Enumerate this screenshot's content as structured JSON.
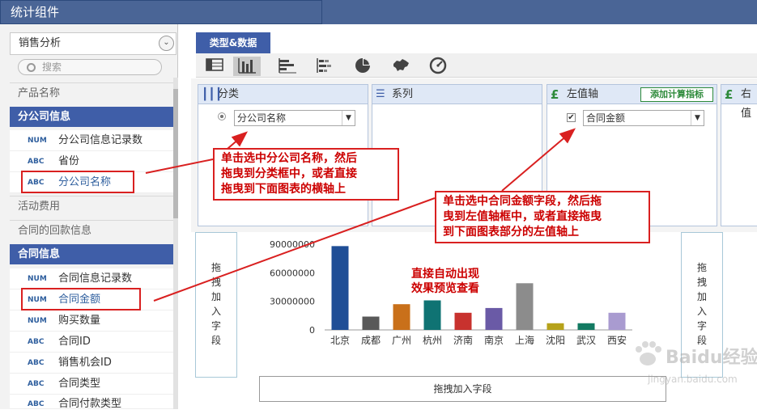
{
  "window": {
    "title": "统计组件"
  },
  "left": {
    "datasource": "销售分析",
    "search_placeholder": "搜索",
    "groups": {
      "product": "产品名称",
      "branch": "分公司信息",
      "activity": "活动费用",
      "payment": "合同的回款信息",
      "contract": "合同信息"
    },
    "branch_fields": [
      {
        "type": "NUM",
        "label": "分公司信息记录数"
      },
      {
        "type": "ABC",
        "label": "省份"
      },
      {
        "type": "ABC",
        "label": "分公司名称"
      }
    ],
    "contract_fields": [
      {
        "type": "NUM",
        "label": "合同信息记录数"
      },
      {
        "type": "NUM",
        "label": "合同金额"
      },
      {
        "type": "NUM",
        "label": "购买数量"
      },
      {
        "type": "ABC",
        "label": "合同ID"
      },
      {
        "type": "ABC",
        "label": "销售机会ID"
      },
      {
        "type": "ABC",
        "label": "合同类型"
      },
      {
        "type": "ABC",
        "label": "合同付款类型"
      }
    ]
  },
  "main": {
    "tab": "类型&数据",
    "chart_types": [
      "table-icon",
      "bar-chart-icon",
      "horizontal-bar-icon",
      "stacked-bar-icon",
      "pie-chart-icon",
      "map-icon",
      "gauge-icon"
    ],
    "wells": {
      "category": {
        "title": "分类",
        "value": "分公司名称"
      },
      "series": {
        "title": "系列"
      },
      "left_axis": {
        "title": "左值轴",
        "add_label": "添加计算指标",
        "value": "合同金额"
      },
      "right_axis": {
        "title": "右值"
      }
    },
    "drop_side": "拖拽加入字段",
    "drop_bottom": "拖拽加入字段",
    "preview_note_1": "直接自动出现",
    "preview_note_2": "效果预览查看"
  },
  "callouts": {
    "c1": [
      "单击选中分公司名称，然后",
      "拖曳到分类框中，或者直接",
      "拖曳到下面图表的横轴上"
    ],
    "c2": [
      "单击选中合同金额字段，然后拖",
      "曳到左值轴框中，或者直接拖曳",
      "到下面图表部分的左值轴上"
    ]
  },
  "watermark": {
    "brand": "Baidu经验",
    "url": "jingyan.baidu.com"
  },
  "colors": {
    "brand": "#3f5ea8",
    "highlight": "#d92020"
  },
  "chart_data": {
    "type": "bar",
    "categories": [
      "北京",
      "成都",
      "广州",
      "杭州",
      "济南",
      "南京",
      "上海",
      "沈阳",
      "武汉",
      "西安"
    ],
    "values": [
      88000000,
      14000000,
      27000000,
      31000000,
      18000000,
      23000000,
      49000000,
      7000000,
      7000000,
      18000000
    ],
    "bar_colors": [
      "#1f4e96",
      "#595959",
      "#c9701a",
      "#0f7373",
      "#c8322e",
      "#6a5aa6",
      "#8c8c8c",
      "#b6a21a",
      "#137a62",
      "#a99bd0"
    ],
    "yticks": [
      "0",
      "30000000",
      "60000000",
      "90000000"
    ],
    "ylim": [
      0,
      90000000
    ]
  }
}
